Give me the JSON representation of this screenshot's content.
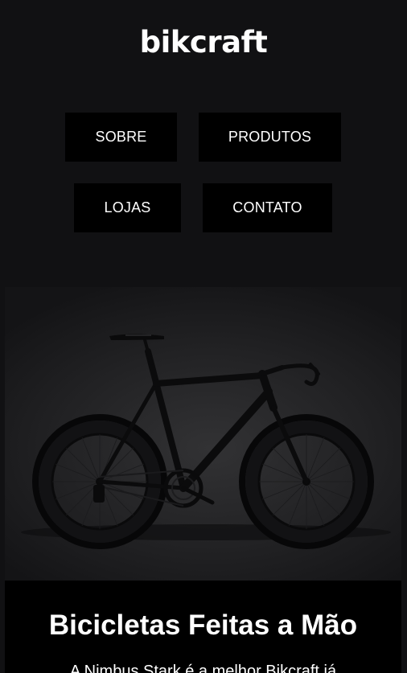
{
  "header": {
    "logo_text": "bikcraft"
  },
  "nav": {
    "items": [
      {
        "label": "SOBRE"
      },
      {
        "label": "PRODUTOS"
      },
      {
        "label": "LOJAS"
      },
      {
        "label": "CONTATO"
      }
    ]
  },
  "intro": {
    "title": "Bicicletas Feitas a Mão",
    "text": "A Nimbus Stark é a melhor Bikcraft já"
  },
  "colors": {
    "background": "#111113",
    "button_background": "#000000",
    "text": "#ffffff"
  }
}
